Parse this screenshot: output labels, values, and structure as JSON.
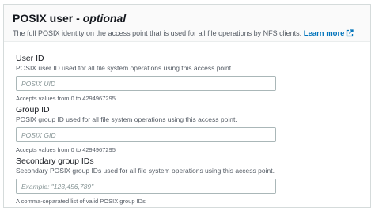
{
  "header": {
    "title": "POSIX user",
    "title_separator": " - ",
    "title_optional": "optional",
    "description": "The full POSIX identity on the access point that is used for all file operations by NFS clients.",
    "learn_more": "Learn more"
  },
  "fields": {
    "user_id": {
      "label": "User ID",
      "description": "POSIX user ID used for all file system operations using this access point.",
      "value": "",
      "placeholder": "POSIX UID",
      "hint": "Accepts values from 0 to 4294967295"
    },
    "group_id": {
      "label": "Group ID",
      "description": "POSIX group ID used for all file system operations using this access point.",
      "value": "",
      "placeholder": "POSIX GID",
      "hint": "Accepts values from 0 to 4294967295"
    },
    "secondary_group_ids": {
      "label": "Secondary group IDs",
      "description": "Secondary POSIX group IDs used for all file system operations using this access point.",
      "value": "",
      "placeholder": "Example: \"123,456,789\"",
      "hint": "A comma-separated list of valid POSIX group IDs"
    }
  },
  "icons": {
    "external_link": "external-link-icon"
  },
  "colors": {
    "link": "#0073bb",
    "header_bg": "#fafafa",
    "border": "#d5dbdb"
  }
}
